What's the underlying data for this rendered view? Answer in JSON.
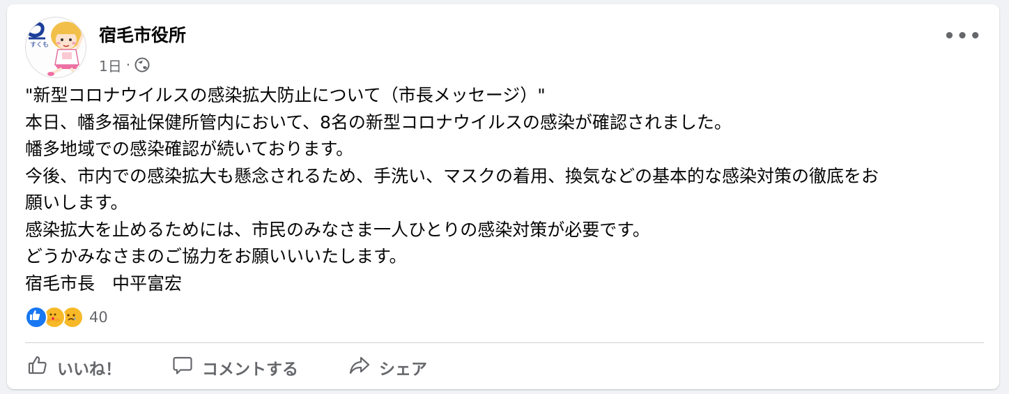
{
  "post": {
    "page_name": "宿毛市役所",
    "timestamp": "1日",
    "separator": "·",
    "privacy_icon": "globe-icon",
    "more_icon": "more-options-icon",
    "more_glyph": "•••",
    "logo_text": "すくも",
    "lines": [
      "\"新型コロナウイルスの感染拡大防止について（市長メッセージ）\"",
      "本日、幡多福祉保健所管内において、8名の新型コロナウイルスの感染が確認されました。",
      "幡多地域での感染確認が続いております。",
      "今後、市内での感染拡大も懸念されるため、手洗い、マスクの着用、換気などの基本的な感染対策の徹底をお",
      "願いします。",
      "感染拡大を止めるためには、市民のみなさま一人ひとりの感染対策が必要です。",
      "どうかみなさまのご協力をお願いいいたします。",
      "宿毛市長　中平富宏"
    ]
  },
  "reactions": {
    "types": [
      "like",
      "care",
      "sad"
    ],
    "count": "40"
  },
  "actions": {
    "like_label": "いいね！",
    "comment_label": "コメントする",
    "share_label": "シェア"
  },
  "colors": {
    "accent": "#1877f2",
    "secondary_text": "#65676b",
    "reaction_yellow": "#f7b928"
  }
}
